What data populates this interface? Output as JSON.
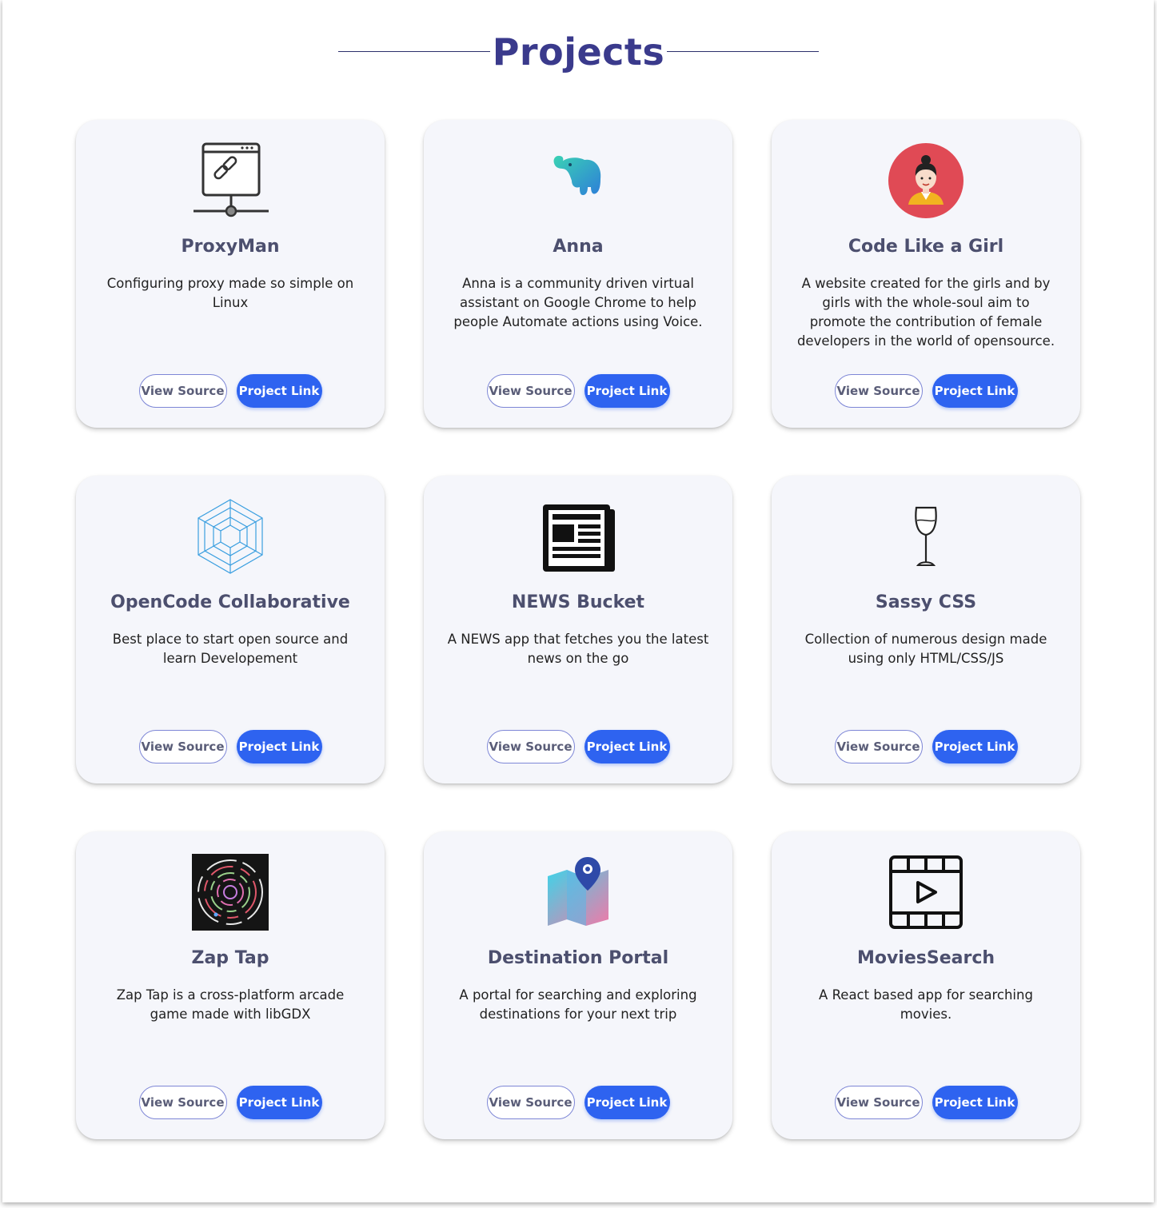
{
  "header": {
    "title": "Projects"
  },
  "buttons": {
    "source_label": "View Source",
    "link_label": "Project Link"
  },
  "projects": [
    {
      "name": "ProxyMan",
      "description": "Configuring proxy made so simple on Linux",
      "icon": "proxy-network-icon"
    },
    {
      "name": "Anna",
      "description": "Anna is a community driven virtual assistant on Google Chrome to help people Automate actions using Voice.",
      "icon": "elephant-icon"
    },
    {
      "name": "Code Like a Girl",
      "description": "A website created for the girls and by girls with the whole-soul aim to promote the contribution of female developers in the world of opensource.",
      "icon": "girl-avatar-icon"
    },
    {
      "name": "OpenCode Collaborative",
      "description": "Best place to start open source and learn Developement",
      "icon": "opencode-logo-icon"
    },
    {
      "name": "NEWS Bucket",
      "description": "A NEWS app that fetches you the latest news on the go",
      "icon": "newspaper-icon"
    },
    {
      "name": "Sassy CSS",
      "description": "Collection of numerous design made using only HTML/CSS/JS",
      "icon": "wine-glass-icon"
    },
    {
      "name": "Zap Tap",
      "description": "Zap Tap is a cross-platform arcade game made with libGDX",
      "icon": "zap-tap-rings-icon"
    },
    {
      "name": "Destination Portal",
      "description": "A portal for searching and exploring destinations for your next trip",
      "icon": "map-pin-icon"
    },
    {
      "name": "MoviesSearch",
      "description": "A React based app for searching movies.",
      "icon": "film-strip-icon"
    }
  ],
  "colors": {
    "title": "#3a3a8c",
    "card_bg": "#f5f6fb",
    "link_button": "#2e63f0",
    "source_border": "#7d86d6"
  }
}
